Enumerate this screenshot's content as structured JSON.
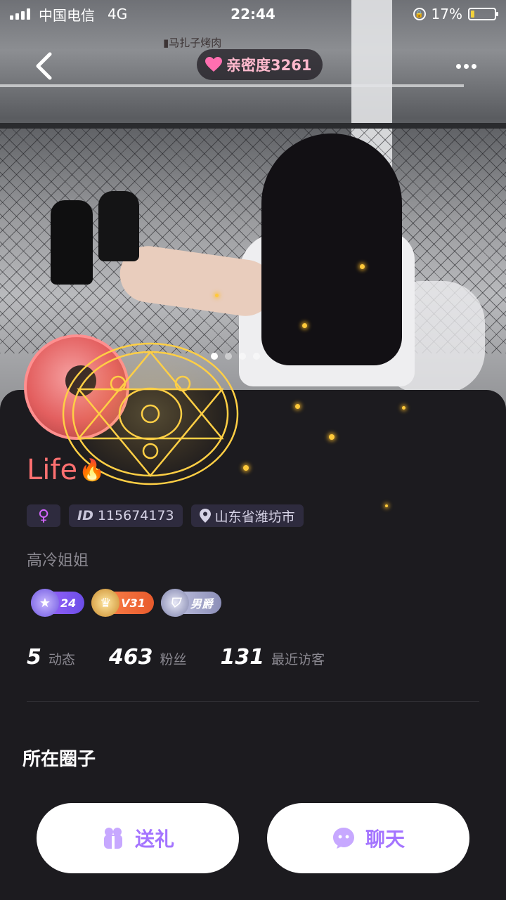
{
  "status_bar": {
    "carrier": "中国电信",
    "network": "4G",
    "time": "22:44",
    "battery_percent": "17%",
    "battery_level": 0.17
  },
  "header": {
    "intimacy_label": "亲密度3261",
    "back_icon": "chevron-left-icon",
    "more_icon": "more-horizontal-icon",
    "photo_page_count": 4,
    "photo_page_active": 1
  },
  "profile": {
    "name": "Life",
    "name_emoji": "🔥",
    "gender_icon": "female-icon",
    "id_label": "ID",
    "id_value": "115674173",
    "location": "山东省潍坊市",
    "bio": "高冷姐姐",
    "badges": [
      {
        "text": "24",
        "icon": "star-level-icon"
      },
      {
        "text": "V31",
        "icon": "vip-crown-icon"
      },
      {
        "text": "男爵",
        "icon": "baron-shield-icon"
      }
    ],
    "stats": [
      {
        "value": "5",
        "label": "动态"
      },
      {
        "value": "463",
        "label": "粉丝"
      },
      {
        "value": "131",
        "label": "最近访客"
      }
    ]
  },
  "circles": {
    "title": "所在圈子"
  },
  "actions": {
    "gift_label": "送礼",
    "chat_label": "聊天"
  },
  "colors": {
    "accent": "#a474ff",
    "name": "#ff7070",
    "background": "#1c1b1f",
    "intimacy": "#ffb9cd"
  }
}
